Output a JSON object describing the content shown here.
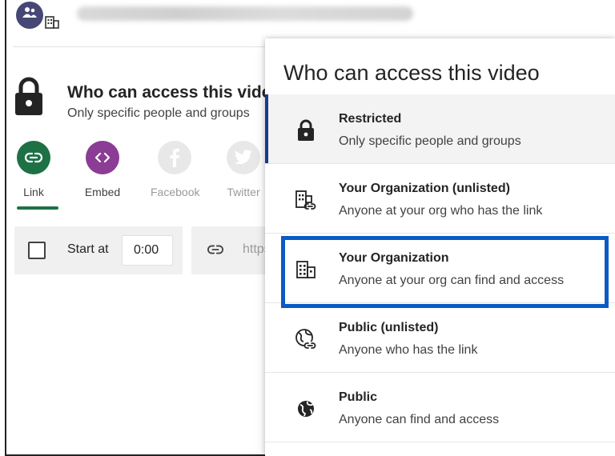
{
  "share": {
    "title": "Who can access this video",
    "subtitle": "Only specific people and groups",
    "buttons": [
      {
        "label": "Link",
        "icon": "link-icon",
        "color": "#1e7145"
      },
      {
        "label": "Embed",
        "icon": "embed-icon",
        "color": "#8b3c94"
      },
      {
        "label": "Facebook",
        "icon": "facebook-icon",
        "color": "#e8e8e8"
      },
      {
        "label": "Twitter",
        "icon": "twitter-icon",
        "color": "#e8e8e8"
      }
    ],
    "start_at_label": "Start at",
    "start_at_value": "0:00",
    "url_prefix": "https"
  },
  "dropdown": {
    "title": "Who can access this video",
    "options": [
      {
        "title": "Restricted",
        "description": "Only specific people and groups",
        "icon": "lock-icon"
      },
      {
        "title": "Your Organization (unlisted)",
        "description": "Anyone at your org who has the link",
        "icon": "org-link-icon"
      },
      {
        "title": "Your Organization",
        "description": "Anyone at your org can find and access",
        "icon": "org-icon"
      },
      {
        "title": "Public (unlisted)",
        "description": "Anyone who has the link",
        "icon": "globe-link-icon"
      },
      {
        "title": "Public",
        "description": "Anyone can find and access",
        "icon": "globe-icon"
      }
    ],
    "selected_index": 0,
    "highlighted_index": 2
  },
  "colors": {
    "accent": "#1b3a8f",
    "highlight": "#0a5bc4",
    "avatar": "#464775"
  }
}
